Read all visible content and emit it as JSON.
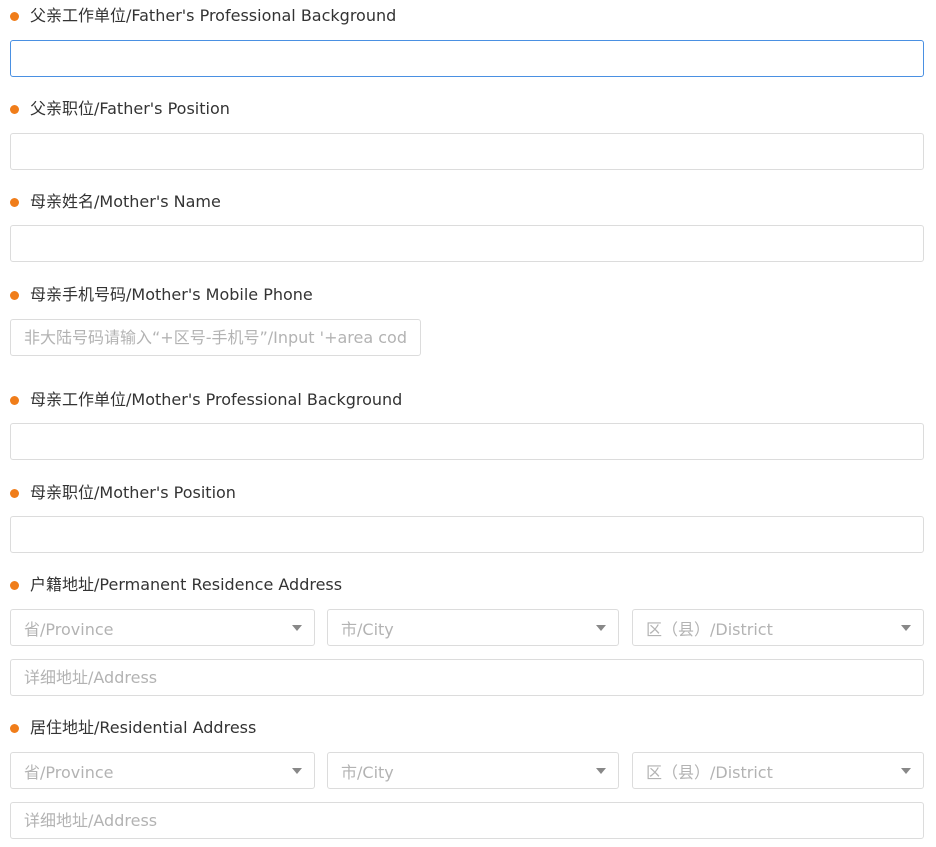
{
  "theme": {
    "required_dot_color": "#f07d1a",
    "focus_border_color": "#4a90e2"
  },
  "fields": {
    "father_work": {
      "label": "父亲工作单位/Father's Professional Background",
      "value": "",
      "placeholder": ""
    },
    "father_position": {
      "label": "父亲职位/Father's Position",
      "value": "",
      "placeholder": ""
    },
    "mother_name": {
      "label": "母亲姓名/Mother's Name",
      "value": "",
      "placeholder": ""
    },
    "mother_phone": {
      "label": "母亲手机号码/Mother's Mobile Phone",
      "value": "",
      "placeholder": "非大陆号码请输入“+区号-手机号”/Input '+area code-mobile phone number' for non-mainland numbers"
    },
    "mother_work": {
      "label": "母亲工作单位/Mother's Professional Background",
      "value": "",
      "placeholder": ""
    },
    "mother_position": {
      "label": "母亲职位/Mother's Position",
      "value": "",
      "placeholder": ""
    },
    "permanent_address": {
      "label": "户籍地址/Permanent Residence Address",
      "province": "省/Province",
      "city": "市/City",
      "district": "区（县）/District",
      "detail_placeholder": "详细地址/Address"
    },
    "residential_address": {
      "label": "居住地址/Residential Address",
      "province": "省/Province",
      "city": "市/City",
      "district": "区（县）/District",
      "detail_placeholder": "详细地址/Address"
    }
  }
}
